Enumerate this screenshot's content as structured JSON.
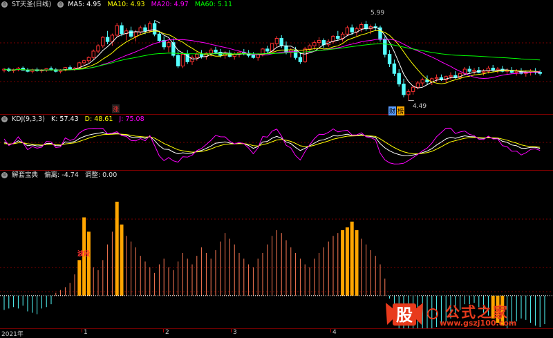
{
  "price_header": {
    "name": "ST天圣(日线)",
    "ma5_label": "MA5: 4.95",
    "ma10_label": "MA10: 4.93",
    "ma20_label": "MA20: 4.97",
    "ma60_label": "MA60: 5.11"
  },
  "price_annotations": {
    "high": "5.99",
    "low": "4.49",
    "zhang": "涨",
    "cai": "财",
    "bang": "榜"
  },
  "kdj_header": {
    "name": "KDJ(9,3,3)",
    "k": "K: 57.43",
    "d": "D: 48.61",
    "j": "J: 75.08"
  },
  "ind_header": {
    "name": "解套宝典",
    "piancha": "偏离: -4.74",
    "tiaozheng": "调整: 0.00"
  },
  "ind_annotation": "波段",
  "x_axis": {
    "labels": [
      "2021年",
      "1",
      "2",
      "3",
      "4"
    ]
  },
  "logo": {
    "glyph": "股",
    "name": "公式之家",
    "url": "www.gszj100.com"
  },
  "colors": {
    "bg": "#000000",
    "grid": "#7a0000",
    "up": "#ff3232",
    "down": "#54ffff",
    "ma5": "#ffffff",
    "ma10": "#ffff00",
    "ma20": "#ff00ff",
    "ma60": "#00ff00",
    "k": "#ffffff",
    "d": "#ffff00",
    "j": "#ff00ff",
    "ind_pos": "#ff7a55",
    "ind_neg": "#54ffff",
    "ind_hi": "#ffa500"
  },
  "chart_data": {
    "type": "candlestick",
    "price_range": [
      4.3,
      6.2
    ],
    "candles": [
      [
        5.06,
        5.1,
        5.02,
        5.08
      ],
      [
        5.08,
        5.11,
        5.03,
        5.05
      ],
      [
        5.05,
        5.09,
        5.01,
        5.07
      ],
      [
        5.07,
        5.12,
        5.04,
        5.1
      ],
      [
        5.1,
        5.13,
        5.05,
        5.06
      ],
      [
        5.06,
        5.1,
        5.02,
        5.04
      ],
      [
        5.04,
        5.09,
        5.0,
        5.07
      ],
      [
        5.07,
        5.11,
        5.03,
        5.05
      ],
      [
        5.05,
        5.08,
        5.01,
        5.06
      ],
      [
        5.06,
        5.1,
        5.03,
        5.09
      ],
      [
        5.09,
        5.13,
        5.05,
        5.07
      ],
      [
        5.07,
        5.1,
        5.02,
        5.04
      ],
      [
        5.04,
        5.08,
        5.0,
        5.06
      ],
      [
        5.06,
        5.12,
        5.04,
        5.11
      ],
      [
        5.11,
        5.15,
        5.06,
        5.08
      ],
      [
        5.08,
        5.12,
        5.05,
        5.1
      ],
      [
        5.1,
        5.22,
        5.08,
        5.2
      ],
      [
        5.2,
        5.26,
        5.14,
        5.24
      ],
      [
        5.24,
        5.32,
        5.2,
        5.3
      ],
      [
        5.3,
        5.45,
        5.27,
        5.42
      ],
      [
        5.42,
        5.55,
        5.38,
        5.52
      ],
      [
        5.52,
        5.7,
        5.48,
        5.68
      ],
      [
        5.68,
        5.8,
        5.55,
        5.6
      ],
      [
        5.6,
        5.75,
        5.52,
        5.72
      ],
      [
        5.72,
        5.95,
        5.68,
        5.9
      ],
      [
        5.9,
        5.96,
        5.7,
        5.75
      ],
      [
        5.75,
        5.85,
        5.62,
        5.8
      ],
      [
        5.8,
        5.88,
        5.66,
        5.7
      ],
      [
        5.7,
        5.82,
        5.6,
        5.78
      ],
      [
        5.78,
        5.9,
        5.72,
        5.86
      ],
      [
        5.86,
        5.92,
        5.74,
        5.8
      ],
      [
        5.8,
        5.98,
        5.76,
        5.94
      ],
      [
        5.94,
        6.0,
        5.7,
        5.74
      ],
      [
        5.74,
        5.8,
        5.58,
        5.62
      ],
      [
        5.62,
        5.7,
        5.45,
        5.5
      ],
      [
        5.5,
        5.62,
        5.4,
        5.58
      ],
      [
        5.58,
        5.66,
        5.3,
        5.34
      ],
      [
        5.34,
        5.42,
        5.1,
        5.14
      ],
      [
        5.14,
        5.4,
        5.1,
        5.36
      ],
      [
        5.36,
        5.44,
        5.18,
        5.22
      ],
      [
        5.22,
        5.34,
        5.16,
        5.3
      ],
      [
        5.3,
        5.4,
        5.24,
        5.36
      ],
      [
        5.36,
        5.44,
        5.28,
        5.32
      ],
      [
        5.32,
        5.4,
        5.26,
        5.38
      ],
      [
        5.38,
        5.48,
        5.32,
        5.44
      ],
      [
        5.44,
        5.5,
        5.36,
        5.4
      ],
      [
        5.4,
        5.46,
        5.3,
        5.34
      ],
      [
        5.34,
        5.42,
        5.28,
        5.38
      ],
      [
        5.38,
        5.44,
        5.3,
        5.32
      ],
      [
        5.32,
        5.4,
        5.26,
        5.36
      ],
      [
        5.36,
        5.42,
        5.3,
        5.4
      ],
      [
        5.4,
        5.46,
        5.34,
        5.38
      ],
      [
        5.38,
        5.44,
        5.3,
        5.34
      ],
      [
        5.34,
        5.4,
        5.28,
        5.3
      ],
      [
        5.3,
        5.38,
        5.24,
        5.36
      ],
      [
        5.36,
        5.48,
        5.32,
        5.46
      ],
      [
        5.46,
        5.52,
        5.38,
        5.42
      ],
      [
        5.42,
        5.58,
        5.4,
        5.56
      ],
      [
        5.56,
        5.7,
        5.5,
        5.66
      ],
      [
        5.66,
        5.72,
        5.48,
        5.52
      ],
      [
        5.52,
        5.6,
        5.36,
        5.4
      ],
      [
        5.4,
        5.48,
        5.3,
        5.44
      ],
      [
        5.44,
        5.5,
        5.26,
        5.3
      ],
      [
        5.3,
        5.4,
        5.18,
        5.22
      ],
      [
        5.22,
        5.5,
        5.2,
        5.46
      ],
      [
        5.46,
        5.56,
        5.4,
        5.52
      ],
      [
        5.52,
        5.62,
        5.44,
        5.58
      ],
      [
        5.58,
        5.68,
        5.5,
        5.62
      ],
      [
        5.62,
        5.66,
        5.48,
        5.54
      ],
      [
        5.54,
        5.64,
        5.5,
        5.6
      ],
      [
        5.6,
        5.72,
        5.56,
        5.7
      ],
      [
        5.7,
        5.8,
        5.62,
        5.66
      ],
      [
        5.66,
        5.78,
        5.6,
        5.74
      ],
      [
        5.74,
        5.9,
        5.7,
        5.86
      ],
      [
        5.86,
        5.92,
        5.72,
        5.78
      ],
      [
        5.78,
        5.88,
        5.7,
        5.84
      ],
      [
        5.84,
        5.96,
        5.78,
        5.92
      ],
      [
        5.92,
        5.99,
        5.8,
        5.84
      ],
      [
        5.84,
        5.92,
        5.74,
        5.88
      ],
      [
        5.88,
        5.94,
        5.8,
        5.86
      ],
      [
        5.86,
        5.9,
        5.6,
        5.64
      ],
      [
        5.64,
        5.7,
        5.3,
        5.36
      ],
      [
        5.36,
        5.44,
        5.12,
        5.18
      ],
      [
        5.18,
        5.26,
        4.95,
        5.0
      ],
      [
        5.0,
        5.08,
        4.75,
        4.8
      ],
      [
        4.8,
        4.9,
        4.55,
        4.6
      ],
      [
        4.6,
        4.7,
        4.49,
        4.66
      ],
      [
        4.66,
        4.78,
        4.6,
        4.74
      ],
      [
        4.74,
        4.86,
        4.7,
        4.82
      ],
      [
        4.82,
        4.92,
        4.76,
        4.88
      ],
      [
        4.88,
        4.96,
        4.8,
        4.84
      ],
      [
        4.84,
        4.92,
        4.78,
        4.9
      ],
      [
        4.9,
        4.98,
        4.84,
        4.92
      ],
      [
        4.92,
        4.98,
        4.86,
        4.88
      ],
      [
        4.88,
        4.96,
        4.82,
        4.94
      ],
      [
        4.94,
        5.02,
        4.88,
        4.96
      ],
      [
        4.96,
        5.04,
        4.9,
        4.92
      ],
      [
        4.92,
        5.02,
        4.88,
        5.0
      ],
      [
        5.0,
        5.12,
        4.96,
        5.08
      ],
      [
        5.08,
        5.14,
        5.0,
        5.04
      ],
      [
        5.04,
        5.1,
        4.98,
        5.06
      ],
      [
        5.06,
        5.12,
        5.0,
        5.02
      ],
      [
        5.02,
        5.08,
        4.96,
        5.04
      ],
      [
        5.04,
        5.14,
        5.0,
        5.1
      ],
      [
        5.1,
        5.16,
        5.02,
        5.06
      ],
      [
        5.06,
        5.12,
        5.0,
        5.08
      ],
      [
        5.08,
        5.14,
        5.02,
        5.04
      ],
      [
        5.04,
        5.1,
        4.98,
        5.06
      ],
      [
        5.06,
        5.12,
        5.0,
        5.02
      ],
      [
        5.02,
        5.08,
        4.96,
        5.04
      ],
      [
        5.04,
        5.1,
        4.98,
        5.0
      ],
      [
        5.0,
        5.06,
        4.94,
        5.02
      ],
      [
        5.02,
        5.08,
        4.96,
        5.04
      ],
      [
        5.04,
        5.1,
        4.98,
        5.02
      ],
      [
        5.02,
        5.06,
        4.96,
        5.0
      ]
    ],
    "indicator_range": [
      -2.0,
      8.0
    ],
    "indicator": [
      -1.0,
      -0.9,
      -0.8,
      -0.9,
      -0.7,
      -1.1,
      -1.2,
      -1.3,
      -0.9,
      -0.8,
      -0.6,
      0.2,
      0.4,
      0.6,
      0.9,
      1.5,
      2.5,
      5.5,
      4.5,
      2.0,
      1.8,
      2.5,
      3.6,
      4.5,
      6.6,
      5.0,
      4.2,
      3.8,
      3.4,
      2.8,
      2.4,
      2.0,
      1.6,
      2.2,
      2.6,
      2.0,
      1.8,
      2.4,
      3.0,
      2.6,
      2.2,
      2.8,
      3.4,
      3.0,
      2.6,
      3.2,
      3.8,
      4.4,
      4.0,
      3.6,
      3.0,
      2.6,
      2.2,
      2.0,
      2.6,
      3.0,
      3.6,
      4.2,
      4.6,
      4.4,
      3.9,
      3.4,
      3.0,
      2.6,
      2.2,
      2.0,
      2.6,
      3.0,
      3.4,
      3.8,
      4.2,
      4.4,
      4.6,
      4.8,
      5.2,
      4.6,
      4.0,
      3.6,
      3.2,
      2.8,
      2.2,
      1.2,
      -0.2,
      -1.5,
      -2.8,
      -3.0,
      -2.9,
      -2.7,
      -2.6,
      -2.8,
      -2.5,
      -2.4,
      -2.2,
      -2.0,
      -1.8,
      -1.6,
      -1.4,
      -1.0,
      -0.6,
      -0.6,
      -0.5,
      -0.8,
      -1.2,
      -1.4,
      -1.6,
      -1.9,
      -2.1,
      -2.3,
      -2.0,
      -1.8,
      -1.6,
      -1.7,
      -1.9,
      -2.1,
      -2.2,
      -2.0
    ],
    "highlight_bars": [
      16,
      17,
      18,
      24,
      25,
      72,
      73,
      74,
      75,
      104,
      105,
      106
    ]
  }
}
